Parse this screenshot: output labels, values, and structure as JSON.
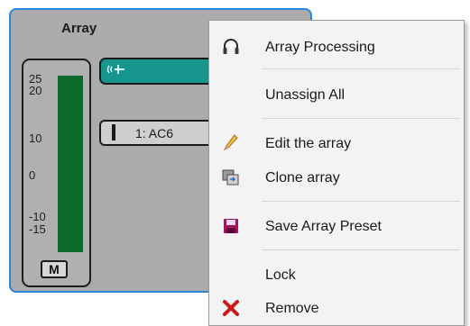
{
  "panel": {
    "title": "Array",
    "meter": {
      "ticks": [
        "25",
        "20",
        "10",
        "0",
        "-10",
        "-15"
      ],
      "mute_label": "M",
      "bar_color": "#0c6a2b"
    },
    "channel_icon": "array-speaker-icon",
    "channel_color": "#17958f",
    "input_label": "1: AC6"
  },
  "menu": {
    "items": [
      {
        "label": "Array Processing",
        "icon": "headphones-icon"
      },
      {
        "label": "Unassign All",
        "icon": ""
      },
      {
        "label": "Edit the array",
        "icon": "pencil-icon"
      },
      {
        "label": "Clone array",
        "icon": "clone-icon"
      },
      {
        "label": "Save Array Preset",
        "icon": "save-icon"
      },
      {
        "label": "Lock",
        "icon": ""
      },
      {
        "label": "Remove",
        "icon": "remove-icon"
      }
    ]
  },
  "colors": {
    "panel_border": "#2b86d6",
    "panel_bg": "#ababab",
    "menu_bg": "#f3f3f3",
    "remove_red": "#cc1a1a",
    "save_magenta": "#a3155f"
  }
}
